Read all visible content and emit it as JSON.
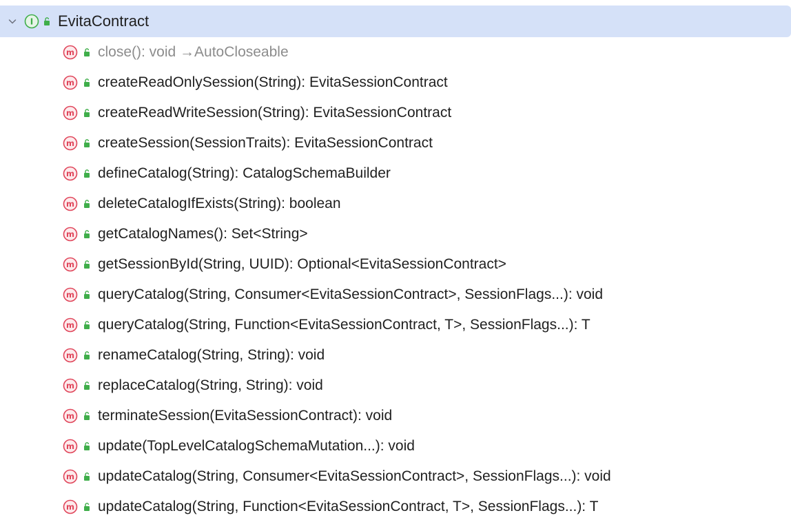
{
  "root": {
    "label": "EvitaContract",
    "icon": "interface-icon",
    "expanded": true
  },
  "colors": {
    "selection_bg": "#d5e1f8",
    "method_icon": "#e0455a",
    "interface_icon": "#3fae4a",
    "lock_icon": "#3fae4a",
    "inherited_text": "#8c8c8c"
  },
  "methods": [
    {
      "label": "close(): void →AutoCloseable",
      "inherited": true
    },
    {
      "label": "createReadOnlySession(String): EvitaSessionContract",
      "inherited": false
    },
    {
      "label": "createReadWriteSession(String): EvitaSessionContract",
      "inherited": false
    },
    {
      "label": "createSession(SessionTraits): EvitaSessionContract",
      "inherited": false
    },
    {
      "label": "defineCatalog(String): CatalogSchemaBuilder",
      "inherited": false
    },
    {
      "label": "deleteCatalogIfExists(String): boolean",
      "inherited": false
    },
    {
      "label": "getCatalogNames(): Set<String>",
      "inherited": false
    },
    {
      "label": "getSessionById(String, UUID): Optional<EvitaSessionContract>",
      "inherited": false
    },
    {
      "label": "queryCatalog(String, Consumer<EvitaSessionContract>, SessionFlags...): void",
      "inherited": false
    },
    {
      "label": "queryCatalog(String, Function<EvitaSessionContract, T>, SessionFlags...): T",
      "inherited": false
    },
    {
      "label": "renameCatalog(String, String): void",
      "inherited": false
    },
    {
      "label": "replaceCatalog(String, String): void",
      "inherited": false
    },
    {
      "label": "terminateSession(EvitaSessionContract): void",
      "inherited": false
    },
    {
      "label": "update(TopLevelCatalogSchemaMutation...): void",
      "inherited": false
    },
    {
      "label": "updateCatalog(String, Consumer<EvitaSessionContract>, SessionFlags...): void",
      "inherited": false
    },
    {
      "label": "updateCatalog(String, Function<EvitaSessionContract, T>, SessionFlags...): T",
      "inherited": false
    }
  ]
}
